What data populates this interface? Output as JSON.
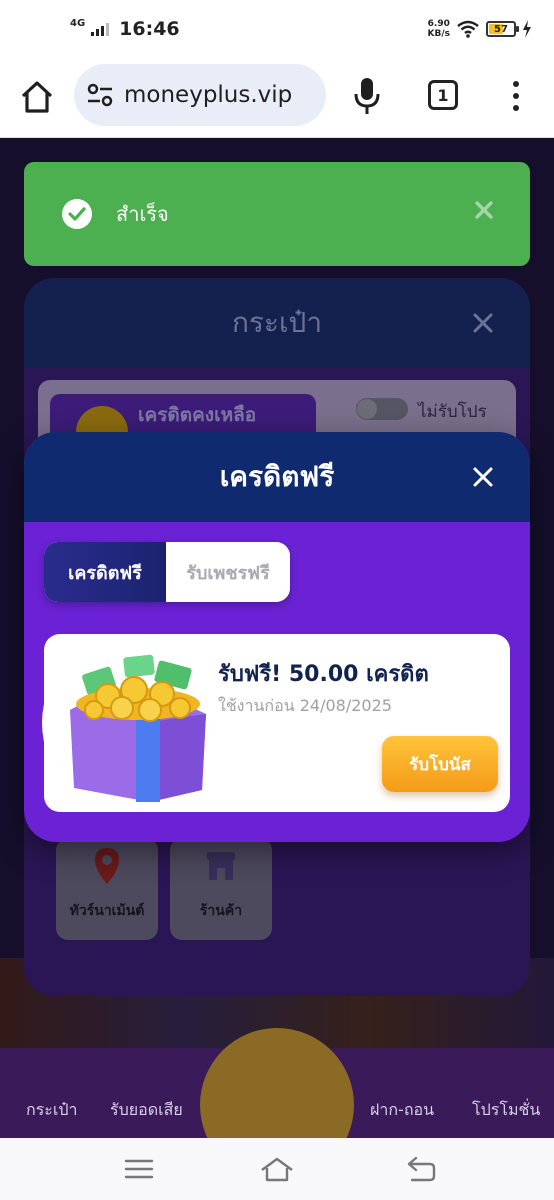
{
  "status_bar": {
    "network": "4G",
    "time": "16:46",
    "speed_value": "6.90",
    "speed_unit": "KB/s",
    "battery": "57",
    "battery_level": 0.57
  },
  "browser": {
    "url": "moneyplus.vip",
    "tab_count": "1",
    "icons": [
      "home-icon",
      "tune-icon",
      "microphone-icon",
      "tabs-icon",
      "more-vert-icon"
    ]
  },
  "toast": {
    "message": "สำเร็จ",
    "color": "#4caf50"
  },
  "wallet_modal": {
    "title": "กระเป๋า",
    "credit_label": "เครดิตคงเหลือ",
    "promo_toggle_label": "ไม่รับโปร",
    "promo_enabled": false,
    "shortcuts": [
      {
        "label": "ทัวร์นาเม้นต์"
      },
      {
        "label": "ร้านค้า"
      }
    ]
  },
  "free_credit_modal": {
    "title": "เครดิตฟรี",
    "tabs": [
      {
        "label": "เครดิตฟรี",
        "active": true
      },
      {
        "label": "รับเพชรฟรี",
        "active": false
      }
    ],
    "reward": {
      "title": "รับฟรี! 50.00 เครดิต",
      "expiry": "ใช้งานก่อน 24/08/2025",
      "button": "รับโบนัส"
    },
    "accent": "#6a22d4",
    "header_color": "#0f2a6e"
  },
  "bottom_nav": {
    "items": [
      {
        "label": "กระเป๋า"
      },
      {
        "label": "รับยอดเสีย"
      },
      {
        "label": "ฝาก-ถอน"
      },
      {
        "label": "โปรโมชั่น"
      }
    ]
  },
  "system_nav": [
    "menu-icon",
    "home-icon",
    "back-icon"
  ]
}
